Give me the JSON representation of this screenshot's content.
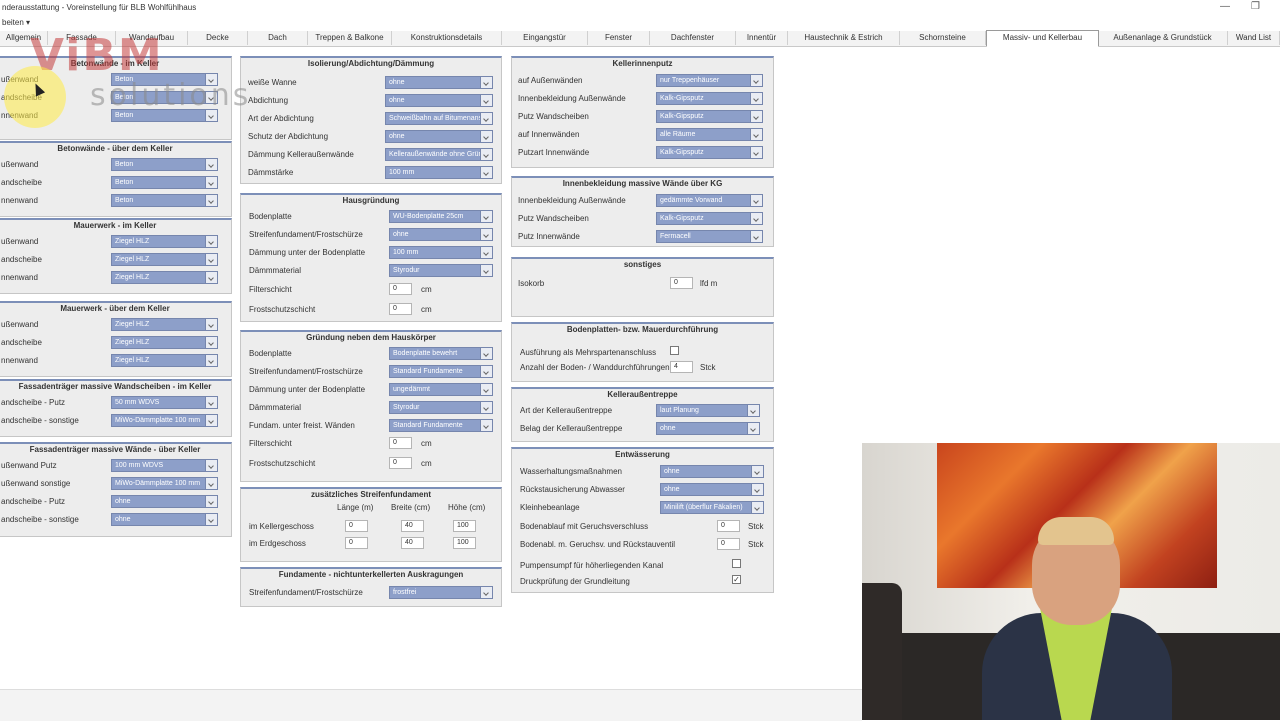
{
  "window": {
    "title": "nderausstattung - Voreinstellung für BLB Wohlfühlhaus",
    "min": "—",
    "restore": "❐"
  },
  "menu": {
    "label": "beiten ▾"
  },
  "tabs": [
    "Allgemein",
    "Fassade",
    "Wandaufbau",
    "Decke",
    "Dach",
    "Treppen & Balkone",
    "Konstruktionsdetails",
    "Eingangstür",
    "Fenster",
    "Dachfenster",
    "Innentür",
    "Haustechnik & Estrich",
    "Schornsteine",
    "Massiv- und Kellerbau",
    "Außenanlage & Grundstück",
    "Wand List"
  ],
  "active_tab": "Massiv- und Kellerbau",
  "logo": {
    "big": "ViBM",
    "small": "solutions"
  },
  "col1": {
    "p1": {
      "title": "Betonwände - im Keller",
      "rows": [
        {
          "label": "ußenwand",
          "value": "Beton"
        },
        {
          "label": "andscheibe",
          "value": "Beton"
        },
        {
          "label": "nnenwand",
          "value": "Beton"
        }
      ]
    },
    "p2": {
      "title": "Betonwände - über dem Keller",
      "rows": [
        {
          "label": "ußenwand",
          "value": "Beton"
        },
        {
          "label": "andscheibe",
          "value": "Beton"
        },
        {
          "label": "nnenwand",
          "value": "Beton"
        }
      ]
    },
    "p3": {
      "title": "Mauerwerk - im Keller",
      "rows": [
        {
          "label": "ußenwand",
          "value": "Ziegel HLZ"
        },
        {
          "label": "andscheibe",
          "value": "Ziegel HLZ"
        },
        {
          "label": "nnenwand",
          "value": "Ziegel HLZ"
        }
      ]
    },
    "p4": {
      "title": "Mauerwerk - über dem Keller",
      "rows": [
        {
          "label": "ußenwand",
          "value": "Ziegel HLZ"
        },
        {
          "label": "andscheibe",
          "value": "Ziegel HLZ"
        },
        {
          "label": "nnenwand",
          "value": "Ziegel HLZ"
        }
      ]
    },
    "p5": {
      "title": "Fassadenträger massive Wandscheiben - im Keller",
      "rows": [
        {
          "label": "andscheibe - Putz",
          "value": "50 mm WDVS"
        },
        {
          "label": "andscheibe - sonstige",
          "value": "MiWo-Dämmplatte 100 mm"
        }
      ]
    },
    "p6": {
      "title": "Fassadenträger massive Wände - über Keller",
      "rows": [
        {
          "label": "ußenwand Putz",
          "value": "100 mm WDVS"
        },
        {
          "label": "ußenwand sonstige",
          "value": "MiWo-Dämmplatte 100 mm"
        },
        {
          "label": "andscheibe - Putz",
          "value": "ohne"
        },
        {
          "label": "andscheibe - sonstige",
          "value": "ohne"
        }
      ]
    }
  },
  "col2": {
    "p1": {
      "title": "Isolierung/Abdichtung/Dämmung",
      "rows": [
        {
          "label": "weiße Wanne",
          "value": "ohne"
        },
        {
          "label": "Abdichtung",
          "value": "ohne"
        },
        {
          "label": "Art der Abdichtung",
          "value": "Schweißbahn auf Bitumenanstrich"
        },
        {
          "label": "Schutz der Abdichtung",
          "value": "ohne"
        },
        {
          "label": "Dämmung Kelleraußenwände",
          "value": "Kelleraußenwände ohne Gründ"
        },
        {
          "label": "Dämmstärke",
          "value": "100 mm"
        }
      ]
    },
    "p2": {
      "title": "Hausgründung",
      "rows": [
        {
          "label": "Bodenplatte",
          "value": "WU-Bodenplatte 25cm"
        },
        {
          "label": "Streifenfundament/Frostschürze",
          "value": "ohne"
        },
        {
          "label": "Dämmung unter der Bodenplatte",
          "value": "100 mm"
        },
        {
          "label": "Dämmmaterial",
          "value": "Styrodur"
        }
      ],
      "inputs": [
        {
          "label": "Filterschicht",
          "value": "0",
          "unit": "cm"
        },
        {
          "label": "Frostschutzschicht",
          "value": "0",
          "unit": "cm"
        }
      ]
    },
    "p3": {
      "title": "Gründung neben dem Hauskörper",
      "rows": [
        {
          "label": "Bodenplatte",
          "value": "Bodenplatte bewehrt"
        },
        {
          "label": "Streifenfundament/Frostschürze",
          "value": "Standard Fundamente"
        },
        {
          "label": "Dämmung unter der Bodenplatte",
          "value": "ungedämmt"
        },
        {
          "label": "Dämmmaterial",
          "value": "Styrodur"
        },
        {
          "label": "Fundam. unter freist. Wänden",
          "value": "Standard Fundamente"
        }
      ],
      "inputs": [
        {
          "label": "Filterschicht",
          "value": "0",
          "unit": "cm"
        },
        {
          "label": "Frostschutzschicht",
          "value": "0",
          "unit": "cm"
        }
      ]
    },
    "p4": {
      "title": "zusätzliches Streifenfundament",
      "headers": [
        "Länge (m)",
        "Breite (cm)",
        "Höhe (cm)"
      ],
      "rows": [
        {
          "label": "im Kellergeschoss",
          "values": [
            "0",
            "40",
            "100"
          ]
        },
        {
          "label": "im Erdgeschoss",
          "values": [
            "0",
            "40",
            "100"
          ]
        }
      ]
    },
    "p5": {
      "title": "Fundamente - nichtunterkellerten Auskragungen",
      "rows": [
        {
          "label": "Streifenfundament/Frostschürze",
          "value": "frostfrei"
        }
      ]
    }
  },
  "col3": {
    "p1": {
      "title": "Kellerinnenputz",
      "rows": [
        {
          "label": "auf Außenwänden",
          "value": "nur Treppenhäuser"
        },
        {
          "label": "Innenbekleidung Außenwände",
          "value": "Kalk-Gipsputz"
        },
        {
          "label": "Putz Wandscheiben",
          "value": "Kalk-Gipsputz"
        },
        {
          "label": "auf Innenwänden",
          "value": "alle Räume"
        },
        {
          "label": "Putzart Innenwände",
          "value": "Kalk-Gipsputz"
        }
      ]
    },
    "p2": {
      "title": "Innenbekleidung massive Wände über KG",
      "rows": [
        {
          "label": "Innenbekleidung Außenwände",
          "value": "gedämmte Vorwand"
        },
        {
          "label": "Putz Wandscheiben",
          "value": "Kalk-Gipsputz"
        },
        {
          "label": "Putz Innenwände",
          "value": "Fermacell"
        }
      ]
    },
    "p3": {
      "title": "sonstiges",
      "input": {
        "label": "Isokorb",
        "value": "0",
        "unit": "lfd m"
      }
    },
    "p4": {
      "title": "Bodenplatten- bzw. Mauerdurchführung",
      "check": {
        "label": "Ausführung als Mehrspartenanschluss",
        "checked": ""
      },
      "input": {
        "label": "Anzahl der Boden- / Wanddurchführungen",
        "value": "4",
        "unit": "Stck"
      }
    },
    "p5": {
      "title": "Kelleraußentreppe",
      "rows": [
        {
          "label": "Art der Kelleraußentreppe",
          "value": "laut Planung"
        },
        {
          "label": "Belag der Kelleraußentreppe",
          "value": "ohne"
        }
      ]
    },
    "p6": {
      "title": "Entwässerung",
      "rows": [
        {
          "label": "Wasserhaltungsmaßnahmen",
          "value": "ohne"
        },
        {
          "label": "Rückstausicherung Abwasser",
          "value": "ohne"
        },
        {
          "label": "Kleinhebeanlage",
          "value": "Minilift (überflur Fäkalien)"
        }
      ],
      "inputs": [
        {
          "label": "Bodenablauf mit Geruchsverschluss",
          "value": "0",
          "unit": "Stck"
        },
        {
          "label": "Bodenabl. m. Geruchsv. und Rückstauventil",
          "value": "0",
          "unit": "Stck"
        }
      ],
      "checks": [
        {
          "label": "Pumpensumpf für höherliegenden Kanal",
          "checked": ""
        },
        {
          "label": "Druckprüfung der Grundleitung",
          "checked": "✓"
        }
      ]
    }
  }
}
